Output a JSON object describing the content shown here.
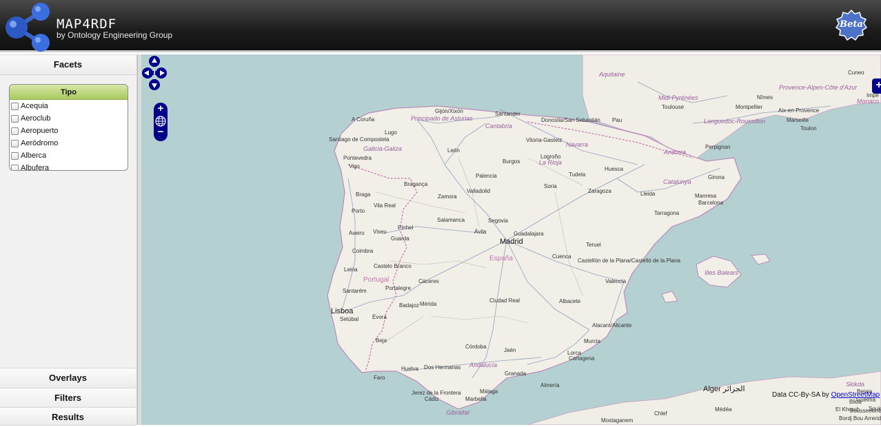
{
  "header": {
    "title": "MAP4RDF",
    "subtitle": "by Ontology Engineering Group",
    "badge": "Beta"
  },
  "sidebar": {
    "facets_label": "Facets",
    "overlays_label": "Overlays",
    "filters_label": "Filters",
    "results_label": "Results",
    "facet": {
      "title": "Tipo",
      "options": [
        "Acequia",
        "Aeroclub",
        "Aeropuerto",
        "Aeródromo",
        "Alberca",
        "Albufera"
      ]
    }
  },
  "map": {
    "cities": [
      "A Coruña",
      "Gijón/Xixón",
      "Santander",
      "Donostia/San Sebastián",
      "Pau",
      "Toulouse",
      "Montpellier",
      "Nîmes",
      "Aix-en-Provence",
      "Marseille",
      "Toulon",
      "Cuneo",
      "Lugo",
      "Santiago de Compostela",
      "León",
      "Vitoria-Gasteiz",
      "Logroño",
      "Pontevedra",
      "Vigo",
      "Burgos",
      "Huesca",
      "Perpignan",
      "Tudela",
      "Palencia",
      "Girona",
      "Bragança",
      "Valladolid",
      "Soria",
      "Zaragoza",
      "Lleida",
      "Braga",
      "Zamora",
      "Barcelona",
      "Vila Real",
      "Manresa",
      "Porto",
      "Tarragona",
      "Salamanca",
      "Segovia",
      "Pinhel",
      "Aveiro",
      "Viseu",
      "Ávila",
      "Guadalajara",
      "Guarda",
      "Teruel",
      "Coimbra",
      "Cuenca",
      "Castellón de la Plana/Castelló de la Plana",
      "Castelo Branco",
      "Leiria",
      "Valencia",
      "Cáceres",
      "Portalegre",
      "Santarém",
      "Ciudad Real",
      "Albacete",
      "Mérida",
      "Badajoz",
      "Setúbal",
      "Évora",
      "Alacant/Alicante",
      "Beja",
      "Murcia",
      "Córdoba",
      "Jaén",
      "Lorca",
      "Cartagena",
      "Huelva",
      "Dos Hermanas",
      "Granada",
      "Faro",
      "Almería",
      "Jerez de la Frontera",
      "Málaga",
      "Cádiz",
      "Marbella",
      "Impe",
      "Bejaia",
      "Blida",
      "Bousseekine",
      "Bordj Bou Arreridj",
      "Chlef",
      "Médéa",
      "El Khroub",
      "Souk A",
      "Mostaganem",
      "Guelma"
    ],
    "big_cities": [
      "Madrid",
      "Lisboa",
      "Alger الجزائر"
    ],
    "regions": [
      "Aquitaine",
      "Midi-Pyrénées",
      "Provence-Alpes-Côte d'Azur",
      "Monaco",
      "Languedoc-Roussillon",
      "Principado de Asturias",
      "Cantabria",
      "Navarra",
      "Galicia-Galiza",
      "La Rioja",
      "Andorra",
      "Catalunya",
      "Illes Balears",
      "Andalucía",
      "Gibraltar",
      "Skikda"
    ],
    "countries": [
      "España",
      "Portugal"
    ],
    "attribution_prefix": "Data CC-By-SA by",
    "attribution_link": "OpenStreetMap",
    "layer_switcher": "+"
  },
  "controls": {
    "zoom_in": "+",
    "zoom_out": "−"
  }
}
